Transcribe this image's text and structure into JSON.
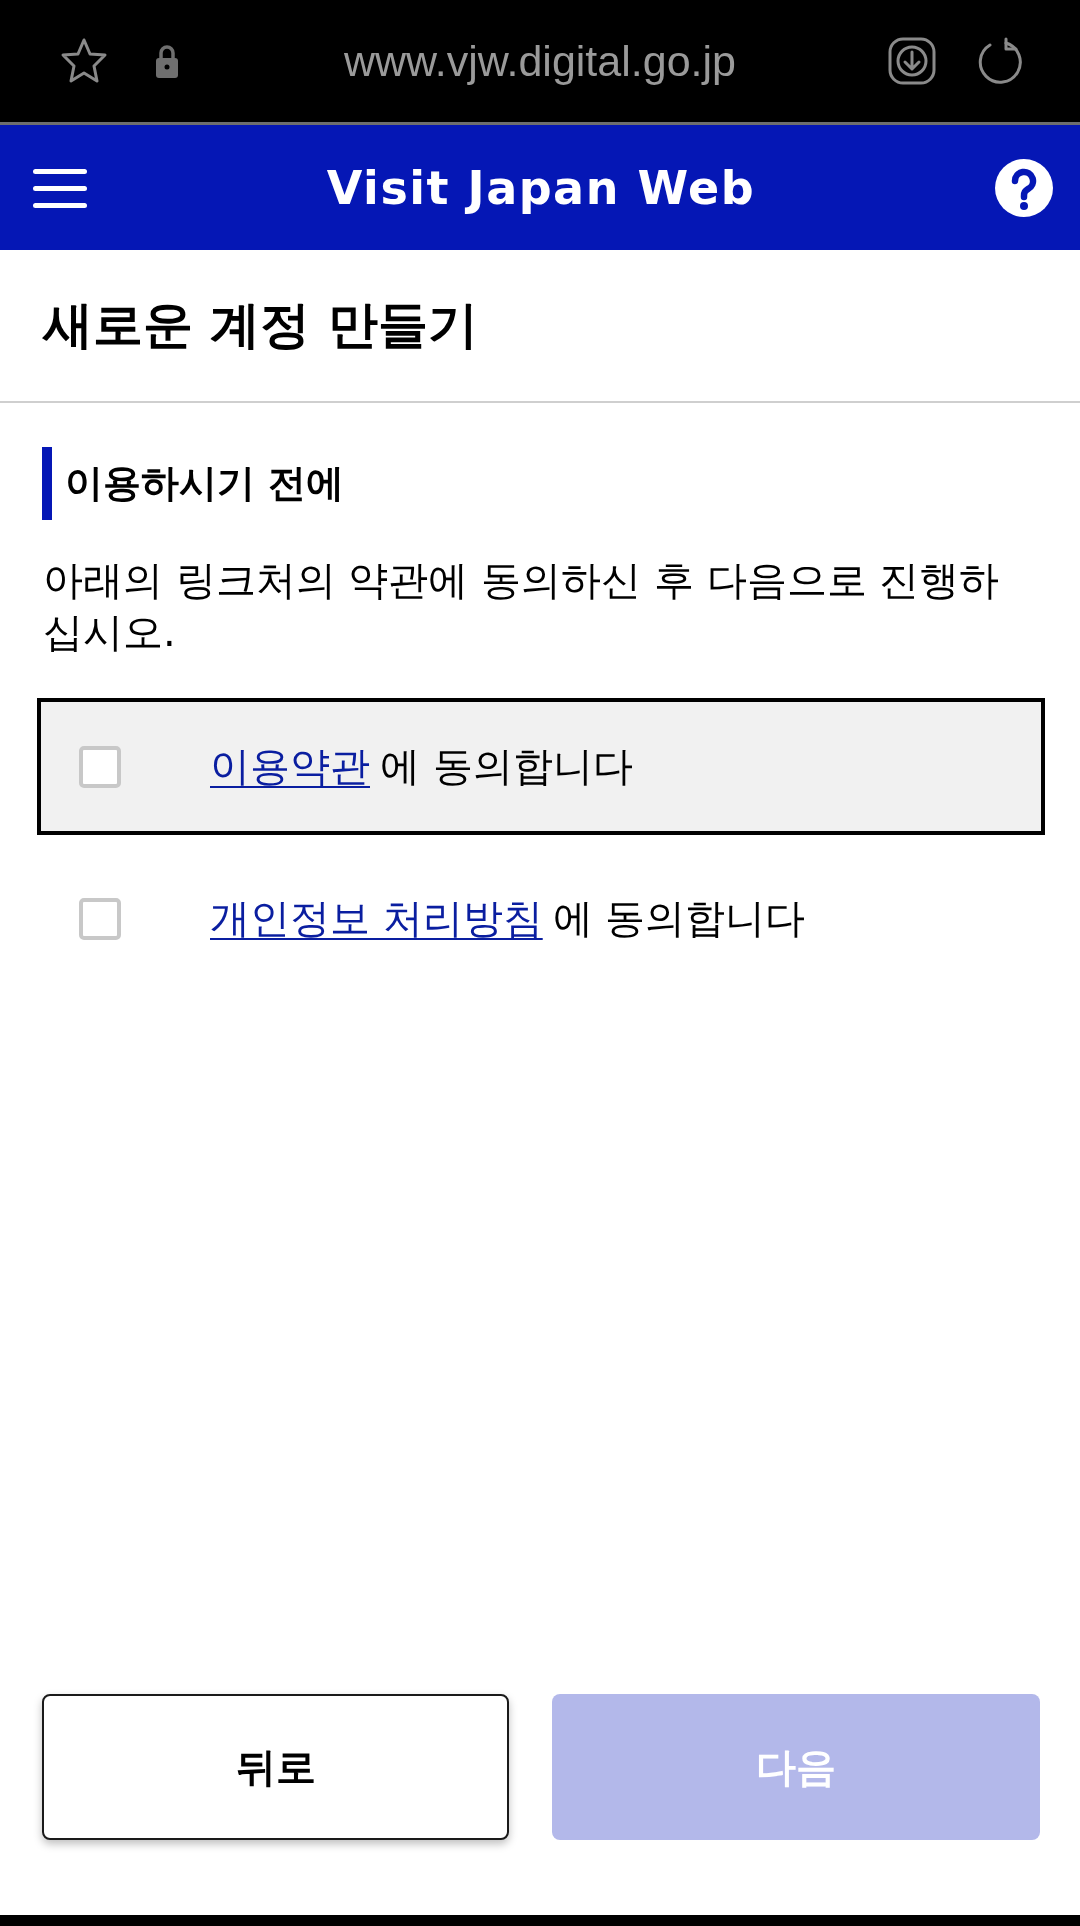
{
  "browser_bar": {
    "url": "www.vjw.digital.go.jp"
  },
  "header": {
    "title": "Visit Japan Web"
  },
  "page": {
    "title": "새로운 계정 만들기"
  },
  "section": {
    "heading": "이용하시기 전에",
    "instruction": "아래의 링크처의 약관에 동의하신 후 다음으로 진행하십시오."
  },
  "agreements": [
    {
      "link": "이용약관",
      "text": "에 동의합니다",
      "checked": false,
      "focused": true
    },
    {
      "link": "개인정보 처리방침",
      "text": "에 동의합니다",
      "checked": false,
      "focused": false
    }
  ],
  "buttons": [
    {
      "label": "뒤로",
      "kind": "secondary",
      "disabled": false
    },
    {
      "label": "다음",
      "kind": "primary",
      "disabled": true
    }
  ]
}
